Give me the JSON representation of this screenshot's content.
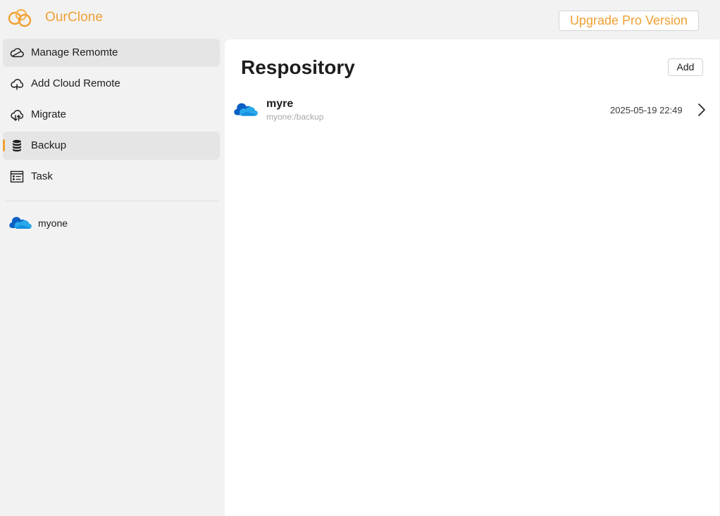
{
  "app": {
    "name": "OurClone",
    "brand_color": "#f0a033",
    "upgrade_label": "Upgrade Pro Version"
  },
  "sidebar": {
    "items": [
      {
        "label": "Manage Remomte",
        "icon": "cloud-icon",
        "active": true
      },
      {
        "label": "Add Cloud Remote",
        "icon": "cloud-add-icon",
        "active": false
      },
      {
        "label": "Migrate",
        "icon": "cloud-sync-icon",
        "active": false
      },
      {
        "label": "Backup",
        "icon": "database-icon",
        "active": true,
        "selected": true
      },
      {
        "label": "Task",
        "icon": "task-list-icon",
        "active": false
      }
    ],
    "remotes": [
      {
        "label": "myone",
        "icon": "onedrive-icon"
      }
    ]
  },
  "main": {
    "title": "Respository",
    "add_label": "Add",
    "repositories": [
      {
        "name": "myre",
        "path": "myone:/backup",
        "date": "2025-05-19 22:49",
        "icon": "onedrive-icon"
      }
    ]
  }
}
